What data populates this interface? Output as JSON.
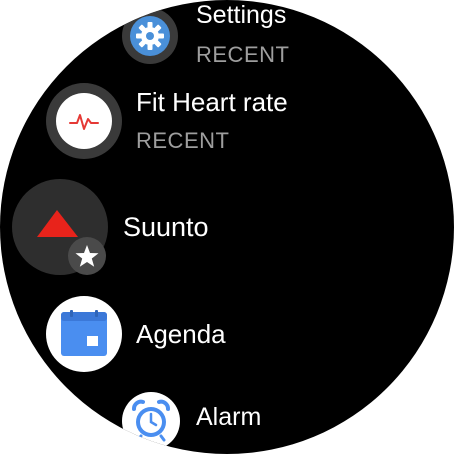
{
  "apps": [
    {
      "name": "Settings",
      "subtitle": "RECENT",
      "icon": "gear-icon",
      "accent": "#4a90d9"
    },
    {
      "name": "Fit Heart rate",
      "subtitle": "RECENT",
      "icon": "heart-rate-icon",
      "accent": "#e53935"
    },
    {
      "name": "Suunto",
      "icon": "suunto-logo-icon",
      "badge_icon": "star-icon",
      "accent": "#e53935"
    },
    {
      "name": "Agenda",
      "icon": "calendar-icon",
      "accent": "#4a8ef0"
    },
    {
      "name": "Alarm",
      "icon": "alarm-clock-icon",
      "accent": "#4a8ef0"
    }
  ],
  "colors": {
    "background": "#000000",
    "label": "#ffffff",
    "subtitle": "#9e9e9e"
  }
}
